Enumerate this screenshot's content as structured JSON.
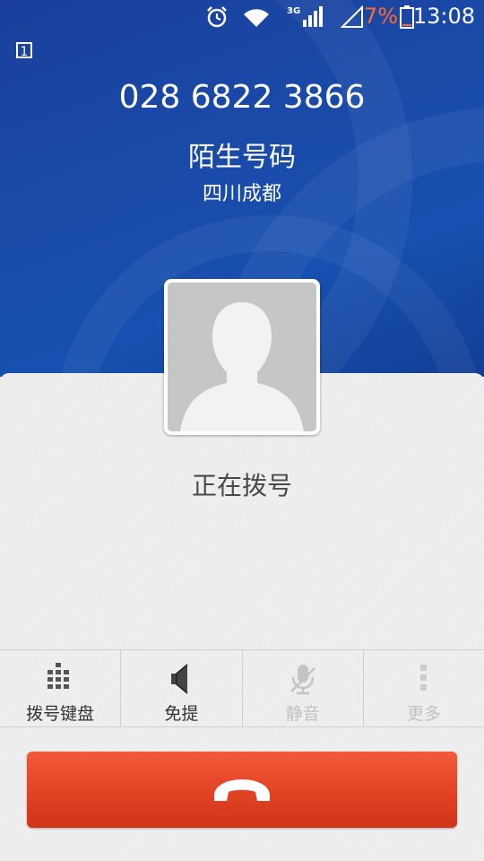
{
  "status_bar": {
    "network_type": "3G",
    "battery_percent": "7%",
    "time": "13:08",
    "icons": [
      "alarm-icon",
      "wifi-icon",
      "signal-icon",
      "no-sim-signal-icon",
      "battery-icon"
    ],
    "battery_color": "#ff6a2b"
  },
  "call": {
    "sim_slot": "1",
    "phone_number": "028 6822 3866",
    "caller_type": "陌生号码",
    "location": "四川成都",
    "status": "正在拨号"
  },
  "actions": [
    {
      "label": "拨号键盘",
      "icon": "dialpad-icon",
      "enabled": true
    },
    {
      "label": "免提",
      "icon": "speaker-icon",
      "enabled": true
    },
    {
      "label": "静音",
      "icon": "mute-icon",
      "enabled": false
    },
    {
      "label": "更多",
      "icon": "more-icon",
      "enabled": false
    }
  ],
  "end_call": {
    "icon": "end-call-icon",
    "color": "#e14224"
  },
  "colors": {
    "background_blue": "#1a4aa8",
    "panel": "#efefef"
  }
}
